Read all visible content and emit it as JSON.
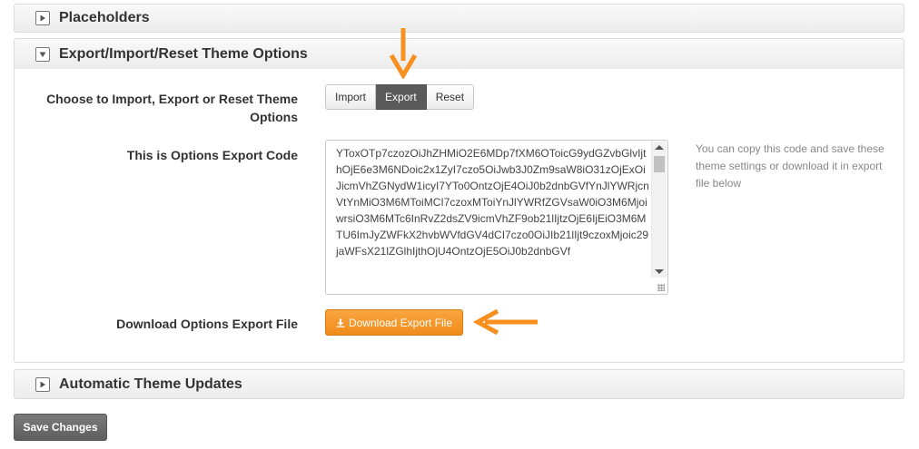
{
  "sections": {
    "placeholders": {
      "title": "Placeholders",
      "state": "collapsed"
    },
    "export_import": {
      "title": "Export/Import/Reset Theme Options",
      "state": "expanded"
    },
    "auto_updates": {
      "title": "Automatic Theme Updates",
      "state": "collapsed"
    }
  },
  "choose_action": {
    "label_line1": "Choose to Import, Export or Reset Theme",
    "label_line2": "Options",
    "options": [
      {
        "label": "Import",
        "active": false
      },
      {
        "label": "Export",
        "active": true
      },
      {
        "label": "Reset",
        "active": false
      }
    ]
  },
  "export_code": {
    "label": "This is Options Export Code",
    "value": "YToxOTp7czozOiJhZHMiO2E6MDp7fXM6OToicG9ydGZvbGlvIjthOjE6e3M6NDoic2x1ZyI7czo5OiJwb3J0Zm9saW8iO31zOjExOiJicmVhZGNydW1icyI7YTo0OntzOjE4OiJ0b2dnbGVfYnJlYWRjcnVtYnMiO3M6MToiMCI7czoxMToiYnJlYWRfZGVsaW0iO3M6MjoiwrsiO3M6MTc6InRvZ2dsZV9icmVhZF9ob21lIjtzOjE6IjEiO3M6MTU6ImJyZWFkX2hvbWVfdGV4dCI7czo0OiJIb21lIjt9czoxMjoic29jaWFsX21lZGlhIjthOjU4OntzOjE5OiJ0b2dnbGVf",
    "help_text": "You can copy this code and save these theme settings or download it in export file below"
  },
  "download": {
    "label": "Download Options Export File",
    "button_label": "Download Export File"
  },
  "save_button_label": "Save Changes",
  "colors": {
    "accent_orange": "#f39a2f",
    "annotation_arrow": "#f7901e",
    "active_segment": "#5a5a5a",
    "save_button": "#666666"
  },
  "icons": {
    "collapsed_toggle": "triangle-right-icon",
    "expanded_toggle": "triangle-down-icon",
    "download": "download-icon",
    "annotation": "orange-arrow-icon"
  }
}
